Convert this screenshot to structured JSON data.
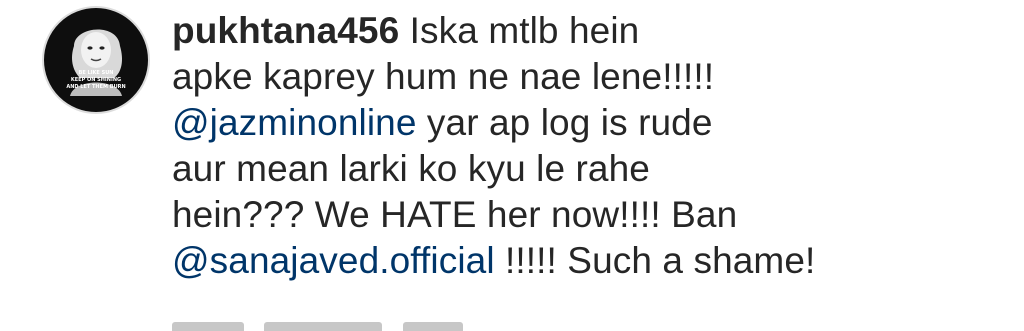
{
  "comment": {
    "avatar": {
      "icon": "profile-photo-icon",
      "badge_text": "BE LIKE SUN\nKEEP ON SHINING\nAND LET THEM BURN"
    },
    "username": "pukhtana456",
    "lines": [
      {
        "parts": [
          {
            "type": "text",
            "value": " Iska mtlb hein"
          }
        ]
      },
      {
        "parts": [
          {
            "type": "text",
            "value": "apke kaprey hum ne nae lene!!!!!"
          }
        ]
      },
      {
        "parts": [
          {
            "type": "mention",
            "value": "@jazminonline"
          },
          {
            "type": "text",
            "value": " yar ap log is rude"
          }
        ]
      },
      {
        "parts": [
          {
            "type": "text",
            "value": "aur mean larki ko kyu le rahe"
          }
        ]
      },
      {
        "parts": [
          {
            "type": "text",
            "value": "hein??? We HATE her now!!!! Ban"
          }
        ]
      },
      {
        "parts": [
          {
            "type": "mention",
            "value": "@sanajaved.official"
          },
          {
            "type": "text",
            "value": " !!!!! Such a shame!"
          }
        ]
      }
    ]
  },
  "colors": {
    "text": "#262626",
    "mention": "#003569",
    "avatar_bg": "#0e0e0e"
  }
}
